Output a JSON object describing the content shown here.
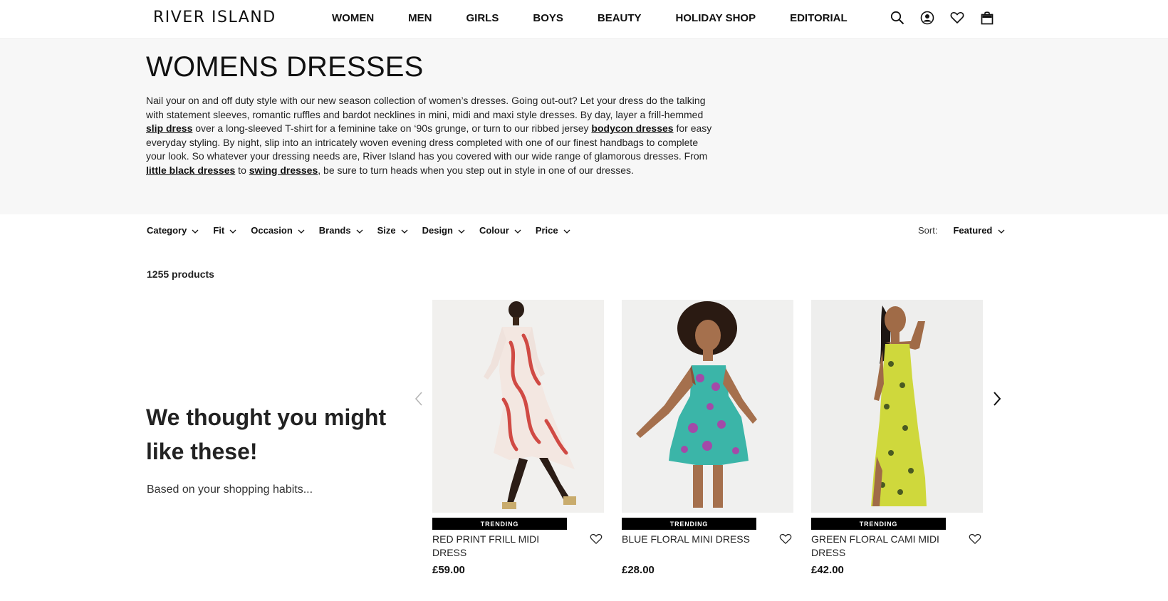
{
  "header": {
    "logo": "RIVER ISLAND",
    "nav": [
      "WOMEN",
      "MEN",
      "GIRLS",
      "BOYS",
      "BEAUTY",
      "HOLIDAY SHOP",
      "EDITORIAL"
    ],
    "icons": [
      "search-icon",
      "account-icon",
      "wishlist-icon",
      "bag-icon"
    ]
  },
  "hero": {
    "title": "WOMENS DRESSES",
    "intro": {
      "t1": "Nail your on and off duty style with our new season collection of women’s dresses. Going out-out? Let your dress do the talking with statement sleeves, romantic ruffles and bardot necklines in mini, midi and maxi style dresses. By day, layer a frill-hemmed ",
      "l1": "slip dress",
      "t2": " over a long-sleeved T-shirt for a feminine take on ‘90s grunge, or turn to our ribbed jersey ",
      "l2": "bodycon dresses",
      "t3": " for easy everyday styling. By night, slip into an intricately woven evening dress completed with one of our finest handbags to complete your look. So whatever your dressing needs are, River Island has you covered with our wide range of glamorous dresses. From ",
      "l3": "little black dresses",
      "t4": " to ",
      "l4": "swing dresses",
      "t5": ", be sure to turn heads when you step out in style in one of our dresses."
    }
  },
  "filters": [
    "Category",
    "Fit",
    "Occasion",
    "Brands",
    "Size",
    "Design",
    "Colour",
    "Price"
  ],
  "sort": {
    "label": "Sort:",
    "value": "Featured"
  },
  "product_count": "1255 products",
  "recommendations": {
    "heading": "We thought you might like these!",
    "subheading": "Based on your shopping habits...",
    "products": [
      {
        "name": "RED PRINT FRILL MIDI DRESS",
        "badge": "TRENDING",
        "price": "£59.00"
      },
      {
        "name": "BLUE FLORAL MINI DRESS",
        "badge": "TRENDING",
        "price": "£28.00"
      },
      {
        "name": "GREEN FLORAL CAMI MIDI DRESS",
        "badge": "TRENDING",
        "price": "£42.00"
      }
    ]
  }
}
